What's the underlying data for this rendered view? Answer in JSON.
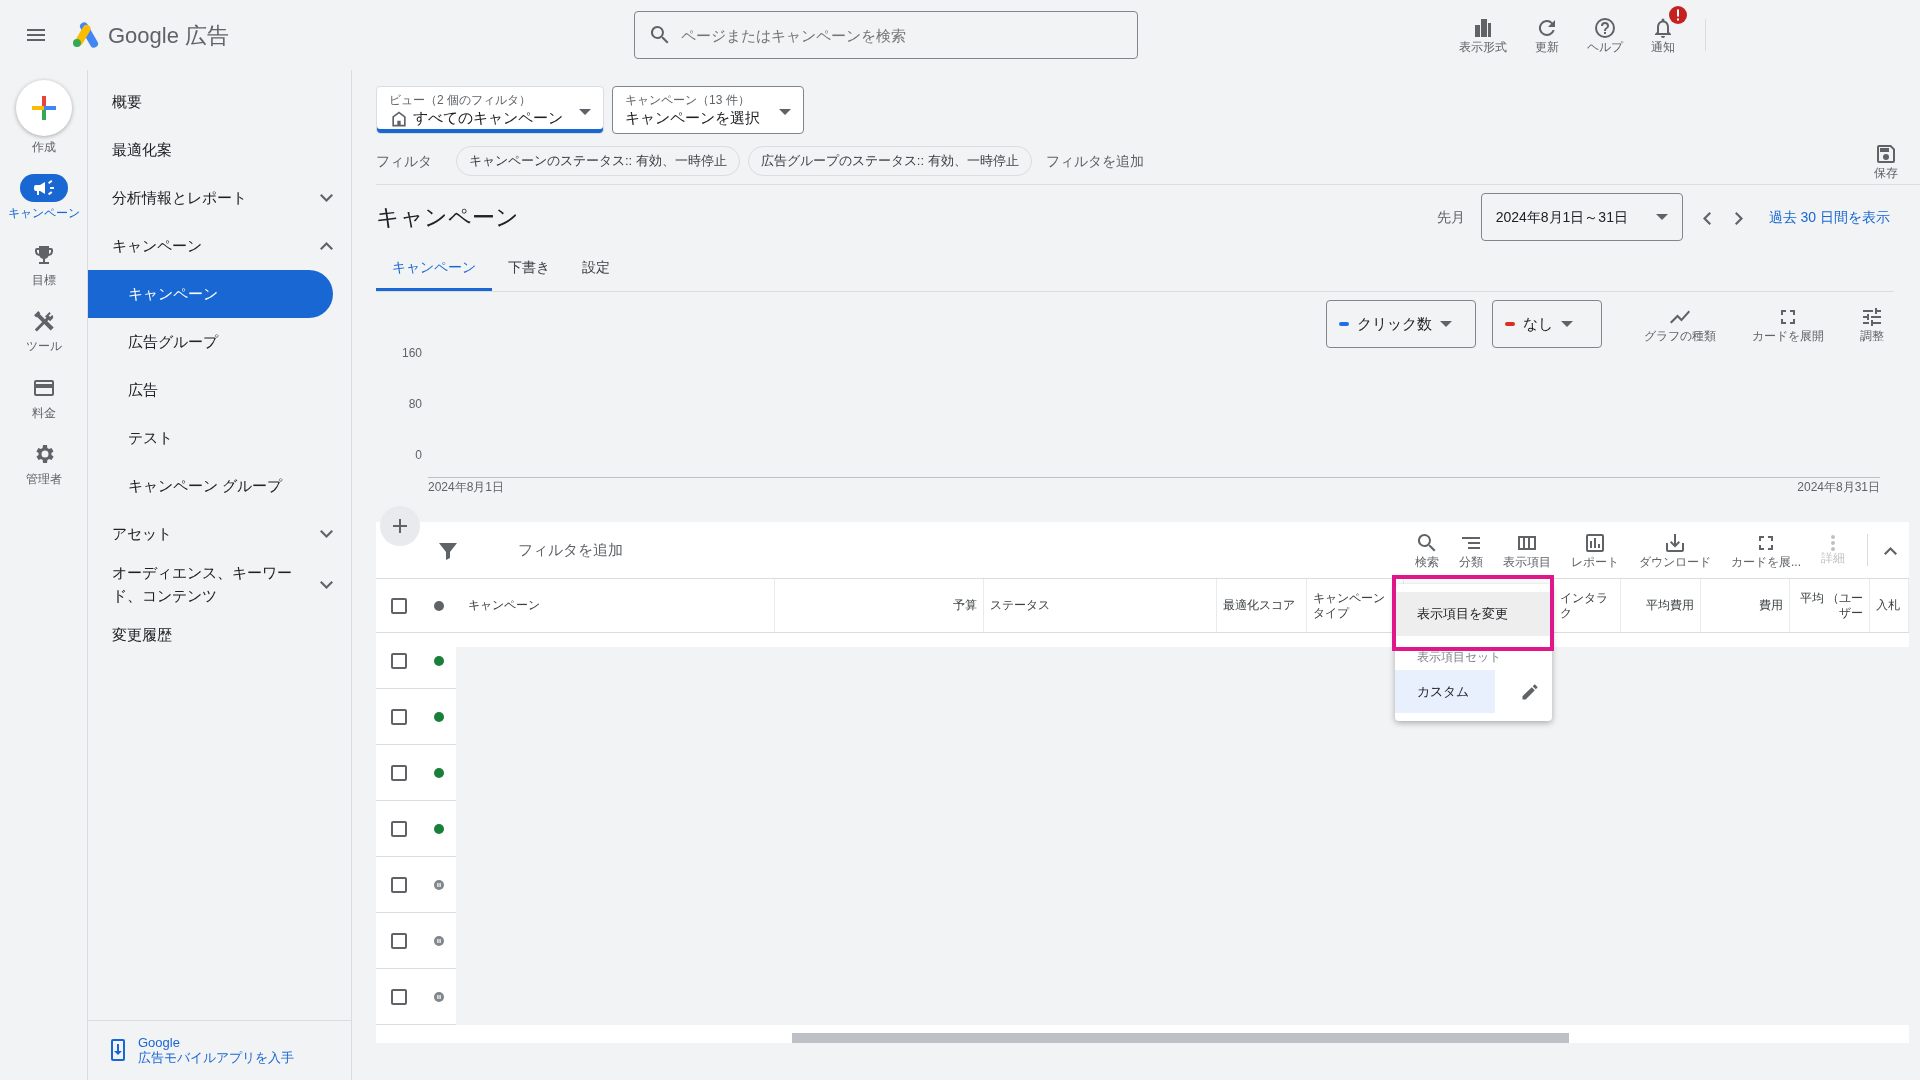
{
  "topbar": {
    "product": "Google 広告",
    "search": {
      "placeholder": "ページまたはキャンペーンを検索"
    },
    "actions": [
      {
        "label": "表示形式",
        "alert": false
      },
      {
        "label": "更新",
        "alert": false
      },
      {
        "label": "ヘルプ",
        "alert": false
      },
      {
        "label": "通知",
        "alert": true
      }
    ]
  },
  "rail": [
    {
      "label": "作成",
      "selected": false
    },
    {
      "label": "キャンペーン",
      "selected": true
    },
    {
      "label": "目標",
      "selected": false
    },
    {
      "label": "ツール",
      "selected": false
    },
    {
      "label": "料金",
      "selected": false
    },
    {
      "label": "管理者",
      "selected": false
    }
  ],
  "nav": {
    "items": [
      {
        "label": "概要",
        "selected": false
      },
      {
        "label": "最適化案",
        "selected": false
      },
      {
        "label": "分析情報とレポート",
        "selected": false,
        "expanded": false
      },
      {
        "label": "キャンペーン",
        "selected": false,
        "expanded": true,
        "children": [
          {
            "label": "キャンペーン",
            "selected": true
          },
          {
            "label": "広告グループ",
            "selected": false
          },
          {
            "label": "広告",
            "selected": false
          },
          {
            "label": "テスト",
            "selected": false
          },
          {
            "label": "キャンペーン グループ",
            "selected": false
          }
        ]
      },
      {
        "label": "アセット",
        "selected": false,
        "expanded": false
      },
      {
        "label": "オーディエンス、キーワード、コンテンツ",
        "selected": false,
        "expanded": false
      },
      {
        "label": "変更履歴",
        "selected": false
      }
    ],
    "footer": {
      "brand": "Google",
      "link": "広告モバイルアプリを入手"
    }
  },
  "selectors": [
    {
      "caption": "ビュー（2 個のフィルタ）",
      "value": "すべてのキャンペーン",
      "focused": true
    },
    {
      "caption": "キャンペーン（13 件）",
      "value": "キャンペーンを選択",
      "focused": false
    }
  ],
  "filters": {
    "label": "フィルタ",
    "chips": [
      "キャンペーンのステータス:: 有効、一時停止",
      "広告グループのステータス:: 有効、一時停止"
    ],
    "add": "フィルタを追加",
    "save": "保存"
  },
  "page_title": "キャンペーン",
  "date": {
    "label": "先月",
    "range": "2024年8月1日～31日",
    "show_last": "過去 30 日間を表示"
  },
  "tabs": [
    {
      "label": "キャンペーン",
      "selected": true
    },
    {
      "label": "下書き",
      "selected": false
    },
    {
      "label": "設定",
      "selected": false
    }
  ],
  "chart": {
    "metrics": [
      {
        "label": "クリック数",
        "color": "#1a73e8"
      },
      {
        "label": "なし",
        "color": "#d93025"
      }
    ],
    "tools": [
      "グラフの種類",
      "カードを展開",
      "調整"
    ],
    "y_labels": [
      "160",
      "80",
      "0"
    ],
    "x_labels": [
      "2024年8月1日",
      "2024年8月31日"
    ]
  },
  "table": {
    "add_filter": "フィルタを追加",
    "tools": [
      {
        "label": "検索",
        "disabled": false
      },
      {
        "label": "分類",
        "disabled": false
      },
      {
        "label": "表示項目",
        "disabled": false
      },
      {
        "label": "レポート",
        "disabled": false
      },
      {
        "label": "ダウンロード",
        "disabled": false
      },
      {
        "label": "カードを展...",
        "disabled": false
      },
      {
        "label": "詳細",
        "disabled": true
      }
    ],
    "select_all": {
      "checked": false
    },
    "columns": [
      "キャンペーン",
      "予算",
      "ステータス",
      "最適化スコア",
      "キャンペーンタイプ",
      "インタラク",
      "平均費用",
      "費用",
      "平均 （ユーザー",
      "入札"
    ],
    "rows": [
      {
        "paused": false,
        "checked": false
      },
      {
        "paused": false,
        "checked": false
      },
      {
        "paused": false,
        "checked": false
      },
      {
        "paused": false,
        "checked": false
      },
      {
        "paused": true,
        "checked": false
      },
      {
        "paused": true,
        "checked": false
      },
      {
        "paused": true,
        "checked": false
      }
    ]
  },
  "menu": {
    "action": "表示項目を変更",
    "section": "表示項目セット",
    "items": [
      {
        "label": "カスタム",
        "selected": true
      }
    ]
  }
}
